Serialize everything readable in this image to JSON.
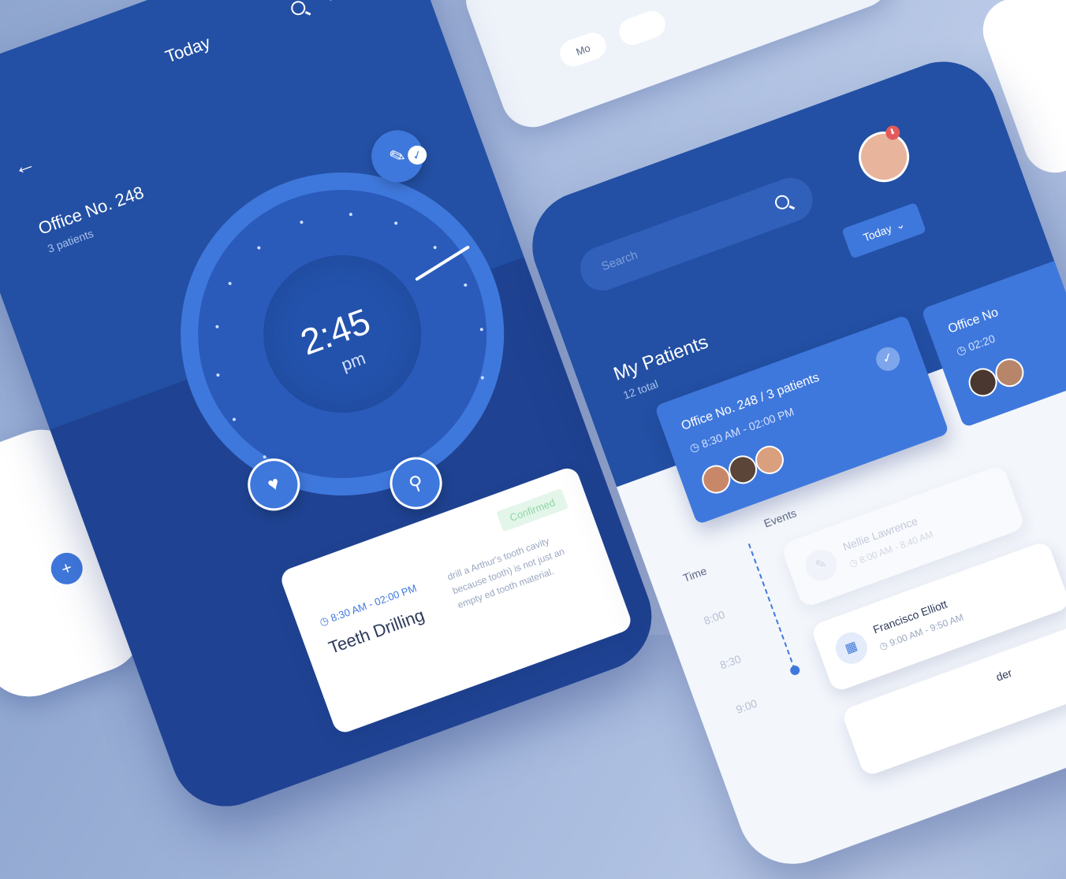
{
  "left_phone": {
    "title": "Today",
    "office_name": "Office No. 248",
    "patients_count": "3 patients",
    "clock_time": "2:45",
    "clock_period": "pm",
    "card": {
      "status": "Confirmed",
      "time": "8:30 AM - 02:00 PM",
      "procedure": "Teeth Drilling",
      "description": "drill a Arthur's tooth cavity because tooth) is not just an empty ed tooth material."
    }
  },
  "right_phone": {
    "search_placeholder": "Search",
    "filter_label": "Today",
    "section_title": "My Patients",
    "section_subtitle": "12 total",
    "office_card": {
      "title": "Office No. 248 / 3 patients",
      "time": "8:30 AM - 02:00 PM"
    },
    "office_card_2": {
      "title": "Office No",
      "time": "02:20"
    },
    "timeline": {
      "time_header": "Time",
      "events_header": "Events",
      "slots": [
        "8:00",
        "8:30",
        "9:00"
      ],
      "events": [
        {
          "name": "Nellie Lawrence",
          "time": "8:00 AM - 8:40 AM"
        },
        {
          "name": "Francisco Elliott",
          "time": "9:00 AM - 9:50 AM"
        },
        {
          "name": "der",
          "time": ""
        }
      ]
    }
  },
  "top_card": {
    "day_label": "Mo"
  },
  "colors": {
    "primary_blue": "#2350a4",
    "accent_blue": "#3f78dc",
    "confirmed_green": "#8fd6a6"
  }
}
